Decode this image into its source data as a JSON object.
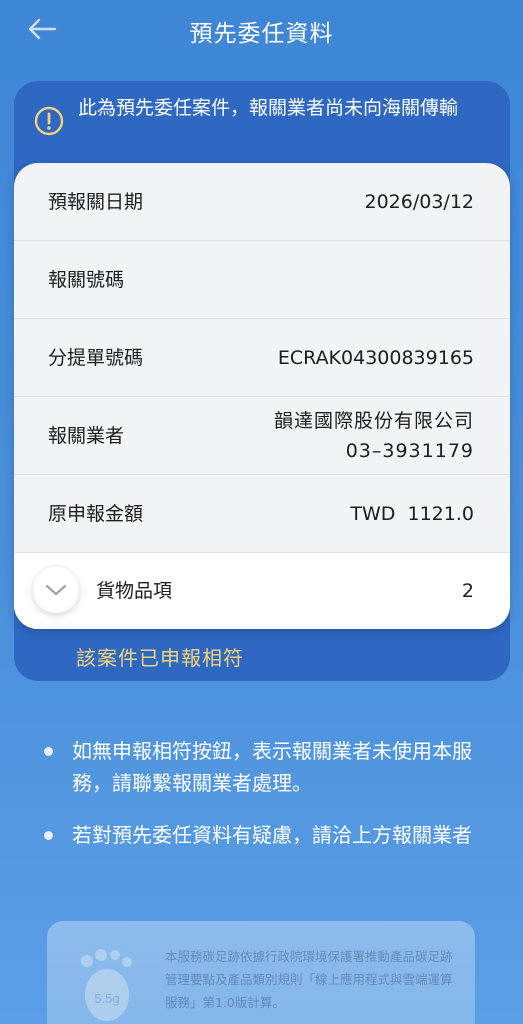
{
  "header": {
    "title": "預先委任資料",
    "back_icon": "arrow-left-icon"
  },
  "notice": {
    "icon": "warning-circle-icon",
    "text": "此為預先委任案件，報關業者尚未向海關傳輸"
  },
  "details": {
    "rows": [
      {
        "label": "預報關日期",
        "value": "2026/03/12"
      },
      {
        "label": "報關號碼",
        "value": ""
      },
      {
        "label": "分提單號碼",
        "value": "ECRAK04300839165"
      },
      {
        "label": "報關業者",
        "value": "韻達國際股份有限公司 03–3931179"
      },
      {
        "label": "原申報金額",
        "value": "TWD  1121.0"
      }
    ],
    "goods": {
      "label": "貨物品項",
      "value": "2",
      "icon": "chevron-down-icon"
    }
  },
  "status": {
    "matched_text": "該案件已申報相符"
  },
  "bullets": [
    "如無申報相符按鈕，表示報關業者未使用本服務，請聯繫報關業者處理。",
    "若對預先委任資料有疑慮，請洽上方報關業者"
  ],
  "footer": {
    "badge": "5.5g",
    "text": "本服務碳足跡依據行政院環境保護署推動產品碳足跡管理要點及產品類別規則「線上應用程式與雲端運算服務」第1.0版計算。"
  },
  "colors": {
    "background": "#4a8fdb",
    "panel": "#2f68c3",
    "card": "#f2f3f5",
    "matched_text": "#f2d27c",
    "warning_icon": "#f2d27c"
  }
}
